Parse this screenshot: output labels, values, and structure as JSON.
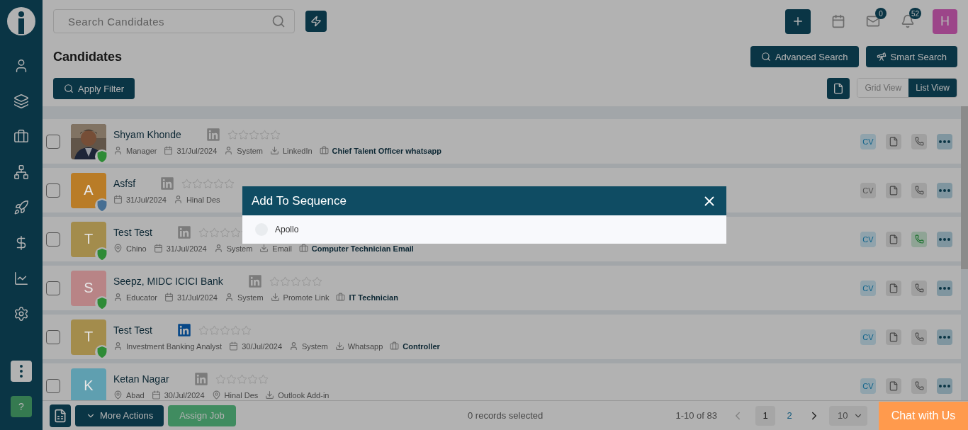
{
  "header": {
    "search_placeholder": "Search Candidates",
    "mail_count": "0",
    "bell_count": "52",
    "avatar_letter": "H"
  },
  "page_title": "Candidates",
  "actions": {
    "advanced_search": "Advanced Search",
    "smart_search": "Smart Search",
    "apply_filter": "Apply Filter"
  },
  "view_toggle": [
    {
      "label": "Grid View",
      "selected": false
    },
    {
      "label": "List View",
      "selected": true
    }
  ],
  "candidates": [
    {
      "name": "Shyam Khonde",
      "checked": false,
      "cv_label": "CV",
      "avatar": {
        "kind": "picture"
      },
      "verified": true,
      "linkedin_active": false,
      "stars": 0,
      "meta": [
        {
          "kind": "person",
          "text": "Manager"
        },
        {
          "kind": "calendar",
          "text": "31/Jul/2024"
        },
        {
          "kind": "person",
          "text": "System"
        },
        {
          "kind": "source",
          "text": "LinkedIn"
        },
        {
          "kind": "job",
          "text": "Chief Talent Officer whatsapp"
        }
      ],
      "cv_active": true,
      "phone_active": false
    },
    {
      "name": "Asfsf",
      "checked": false,
      "cv_label": "CV",
      "avatar": {
        "kind": "letter",
        "letter": "A",
        "color": "#b97c27"
      },
      "verified": false,
      "linkedin_active": false,
      "stars": 0,
      "meta": [
        {
          "kind": "calendar",
          "text": "31/Jul/2024"
        },
        {
          "kind": "person",
          "text": "Hinal Des"
        }
      ],
      "cv_active": false,
      "phone_active": false
    },
    {
      "name": "Test Test",
      "checked": false,
      "cv_label": "CV",
      "avatar": {
        "kind": "letter",
        "letter": "T",
        "color": "#a38c4c"
      },
      "verified": true,
      "linkedin_active": false,
      "meta": [
        {
          "kind": "location",
          "text": "Chino"
        },
        {
          "kind": "calendar",
          "text": "31/Jul/2024"
        },
        {
          "kind": "person",
          "text": "System"
        },
        {
          "kind": "source",
          "text": "Email"
        },
        {
          "kind": "job",
          "text": "Computer Technician Email"
        }
      ],
      "cv_active": true,
      "phone_active": true
    },
    {
      "name": "Seepz, MIDC ICICI Bank",
      "checked": false,
      "cv_label": "CV",
      "avatar": {
        "kind": "letter",
        "letter": "S",
        "color": "#b88486"
      },
      "verified": true,
      "linkedin_active": false,
      "stars": 0,
      "meta": [
        {
          "kind": "person",
          "text": "Educator"
        },
        {
          "kind": "calendar",
          "text": "31/Jul/2024"
        },
        {
          "kind": "person",
          "text": "System"
        },
        {
          "kind": "source",
          "text": "Promote Link"
        },
        {
          "kind": "job",
          "text": "IT Technician"
        }
      ],
      "cv_active": true,
      "phone_active": false
    },
    {
      "name": "Test Test",
      "checked": false,
      "cv_label": "CV",
      "avatar": {
        "kind": "letter",
        "letter": "T",
        "color": "#a38c4c"
      },
      "verified": true,
      "linkedin_active": true,
      "stars": 0,
      "meta": [
        {
          "kind": "person",
          "text": "Investment Banking Analyst"
        },
        {
          "kind": "calendar",
          "text": "30/Jul/2024"
        },
        {
          "kind": "person",
          "text": "System"
        },
        {
          "kind": "source",
          "text": "Whatsapp"
        },
        {
          "kind": "job",
          "text": "Controller"
        }
      ],
      "cv_active": true,
      "phone_active": false
    },
    {
      "name": "Ketan Nagar",
      "checked": false,
      "cv_label": "CV",
      "avatar": {
        "kind": "letter",
        "letter": "K",
        "color": "#5f9fb0"
      },
      "linkedin_active": false,
      "stars": 0,
      "meta": [
        {
          "kind": "location",
          "text": "Abad"
        },
        {
          "kind": "calendar",
          "text": "30/Jul/2024"
        },
        {
          "kind": "location",
          "text": "Hinal Des"
        },
        {
          "kind": "source",
          "text": "Outlook Add-in"
        }
      ],
      "cv_active": true,
      "phone_active": false
    }
  ],
  "footer": {
    "more_actions": "More Actions",
    "assign_job": "Assign Job",
    "selected_text": "0 records selected",
    "range": "1-10 of 83",
    "pages": [
      {
        "label": "1",
        "selected": true
      },
      {
        "label": "2",
        "selected": false
      }
    ],
    "page_size": "10",
    "chat": "Chat with Us"
  },
  "help_label": "?",
  "modal": {
    "title": "Add To Sequence",
    "options": [
      {
        "label": "Apollo",
        "selected": false
      }
    ]
  }
}
